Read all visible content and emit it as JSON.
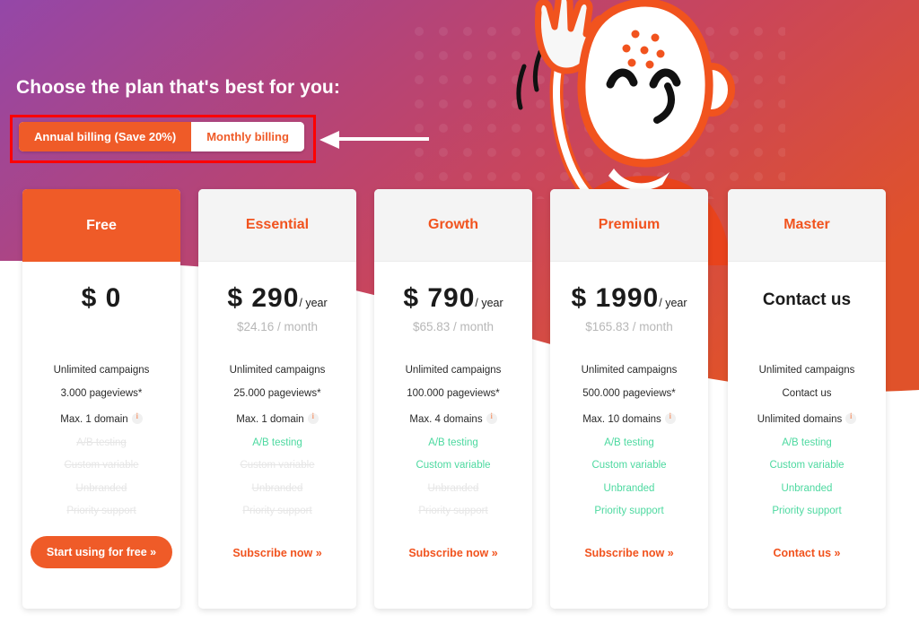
{
  "header": {
    "title": "Choose the plan that's best for you:"
  },
  "billing_toggle": {
    "annual_label": "Annual billing (Save 20%)",
    "monthly_label": "Monthly billing",
    "selected": "annual"
  },
  "annotation": {
    "box_color": "#ff0000",
    "arrow_color": "#ffffff",
    "arrow_direction": "left"
  },
  "colors": {
    "brand_orange": "#ef5b28",
    "accent_green": "#4dd9a0",
    "disabled_gray": "#e6e6e6",
    "gradient_start": "#9447a8",
    "gradient_mid": "#c2456b",
    "gradient_end": "#e0522a",
    "card_head_plain": "#f4f4f4"
  },
  "plans": [
    {
      "name": "Free",
      "featured": true,
      "price_amount": "$ 0",
      "price_period": "",
      "price_monthly": "",
      "contact_price": null,
      "features": [
        {
          "label": "Unlimited campaigns",
          "state": "normal",
          "info": false
        },
        {
          "label": "3.000 pageviews*",
          "state": "normal",
          "info": false
        },
        {
          "label": "Max. 1 domain",
          "state": "normal",
          "info": true
        },
        {
          "label": "A/B testing",
          "state": "off",
          "info": false
        },
        {
          "label": "Custom variable",
          "state": "off",
          "info": false
        },
        {
          "label": "Unbranded",
          "state": "off",
          "info": false
        },
        {
          "label": "Priority support",
          "state": "off",
          "info": false
        }
      ],
      "cta_label": "Start using for free »",
      "cta_style": "button"
    },
    {
      "name": "Essential",
      "featured": false,
      "price_amount": "$ 290",
      "price_period": "/ year",
      "price_monthly": "$24.16 / month",
      "contact_price": null,
      "features": [
        {
          "label": "Unlimited campaigns",
          "state": "normal",
          "info": false
        },
        {
          "label": "25.000 pageviews*",
          "state": "normal",
          "info": false
        },
        {
          "label": "Max. 1 domain",
          "state": "normal",
          "info": true
        },
        {
          "label": "A/B testing",
          "state": "on",
          "info": false
        },
        {
          "label": "Custom variable",
          "state": "off",
          "info": false
        },
        {
          "label": "Unbranded",
          "state": "off",
          "info": false
        },
        {
          "label": "Priority support",
          "state": "off",
          "info": false
        }
      ],
      "cta_label": "Subscribe now »",
      "cta_style": "link"
    },
    {
      "name": "Growth",
      "featured": false,
      "price_amount": "$ 790",
      "price_period": "/ year",
      "price_monthly": "$65.83 / month",
      "contact_price": null,
      "features": [
        {
          "label": "Unlimited campaigns",
          "state": "normal",
          "info": false
        },
        {
          "label": "100.000 pageviews*",
          "state": "normal",
          "info": false
        },
        {
          "label": "Max. 4 domains",
          "state": "normal",
          "info": true
        },
        {
          "label": "A/B testing",
          "state": "on",
          "info": false
        },
        {
          "label": "Custom variable",
          "state": "on",
          "info": false
        },
        {
          "label": "Unbranded",
          "state": "off",
          "info": false
        },
        {
          "label": "Priority support",
          "state": "off",
          "info": false
        }
      ],
      "cta_label": "Subscribe now »",
      "cta_style": "link"
    },
    {
      "name": "Premium",
      "featured": false,
      "price_amount": "$ 1990",
      "price_period": "/ year",
      "price_monthly": "$165.83 / month",
      "contact_price": null,
      "features": [
        {
          "label": "Unlimited campaigns",
          "state": "normal",
          "info": false
        },
        {
          "label": "500.000 pageviews*",
          "state": "normal",
          "info": false
        },
        {
          "label": "Max. 10 domains",
          "state": "normal",
          "info": true
        },
        {
          "label": "A/B testing",
          "state": "on",
          "info": false
        },
        {
          "label": "Custom variable",
          "state": "on",
          "info": false
        },
        {
          "label": "Unbranded",
          "state": "on",
          "info": false
        },
        {
          "label": "Priority support",
          "state": "on",
          "info": false
        }
      ],
      "cta_label": "Subscribe now »",
      "cta_style": "link"
    },
    {
      "name": "Master",
      "featured": false,
      "price_amount": "",
      "price_period": "",
      "price_monthly": "",
      "contact_price": "Contact us",
      "features": [
        {
          "label": "Unlimited campaigns",
          "state": "normal",
          "info": false
        },
        {
          "label": "Contact us",
          "state": "normal",
          "info": false
        },
        {
          "label": "Unlimited domains",
          "state": "normal",
          "info": true
        },
        {
          "label": "A/B testing",
          "state": "on",
          "info": false
        },
        {
          "label": "Custom variable",
          "state": "on",
          "info": false
        },
        {
          "label": "Unbranded",
          "state": "on",
          "info": false
        },
        {
          "label": "Priority support",
          "state": "on",
          "info": false
        }
      ],
      "cta_label": "Contact us »",
      "cta_style": "link"
    }
  ],
  "mascot": {
    "description": "waving-cartoon-character",
    "skin": "#ffffff",
    "outline": "#f1531e",
    "shirt": "#e8431c"
  }
}
